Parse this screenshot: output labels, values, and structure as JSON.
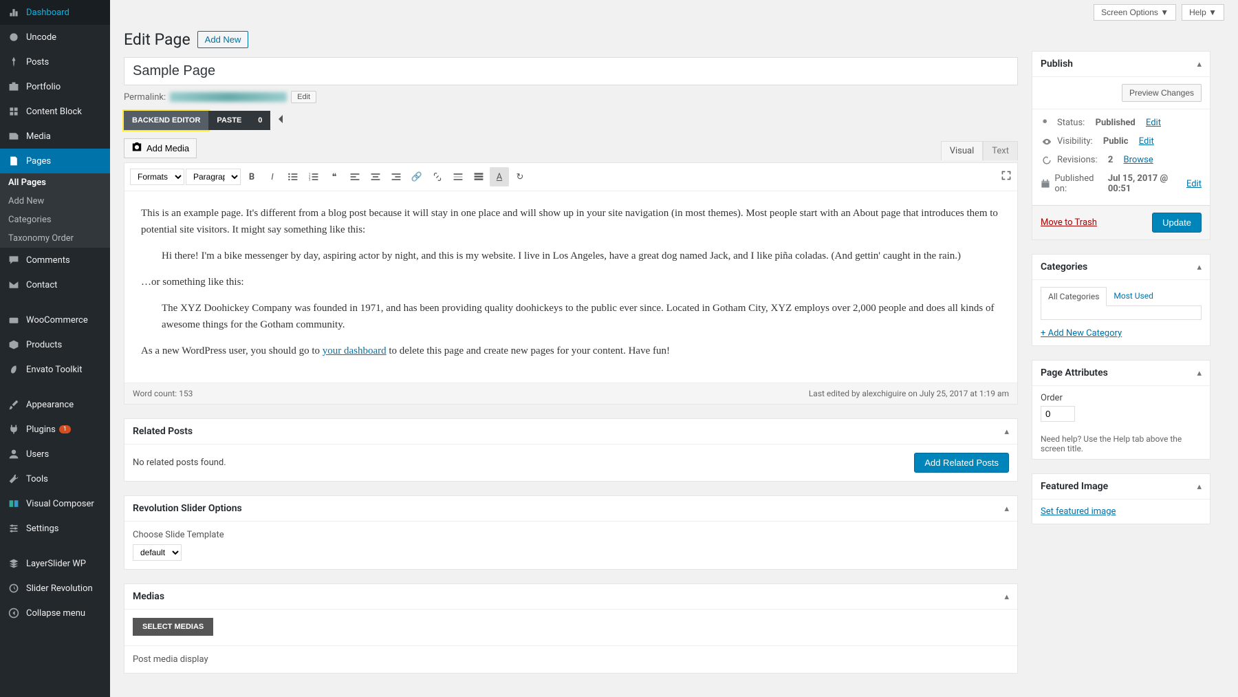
{
  "topbar": {
    "screen_options": "Screen Options",
    "help": "Help"
  },
  "sidebar": {
    "items": [
      {
        "label": "Dashboard"
      },
      {
        "label": "Uncode"
      },
      {
        "label": "Posts"
      },
      {
        "label": "Portfolio"
      },
      {
        "label": "Content Block"
      },
      {
        "label": "Media"
      },
      {
        "label": "Pages"
      },
      {
        "label": "Comments"
      },
      {
        "label": "Contact"
      },
      {
        "label": "WooCommerce"
      },
      {
        "label": "Products"
      },
      {
        "label": "Envato Toolkit"
      },
      {
        "label": "Appearance"
      },
      {
        "label": "Plugins",
        "badge": "1"
      },
      {
        "label": "Users"
      },
      {
        "label": "Tools"
      },
      {
        "label": "Visual Composer"
      },
      {
        "label": "Settings"
      },
      {
        "label": "LayerSlider WP"
      },
      {
        "label": "Slider Revolution"
      },
      {
        "label": "Collapse menu"
      }
    ],
    "sub": {
      "all_pages": "All Pages",
      "add_new": "Add New",
      "categories": "Categories",
      "taxonomy_order": "Taxonomy Order"
    }
  },
  "header": {
    "title": "Edit Page",
    "add_new": "Add New"
  },
  "post": {
    "title": "Sample Page",
    "permalink_label": "Permalink:",
    "edit": "Edit"
  },
  "editor_tabs": {
    "backend": "BACKEND EDITOR",
    "paste": "PASTE",
    "zero": "0"
  },
  "add_media": "Add Media",
  "view_tabs": {
    "visual": "Visual",
    "text": "Text"
  },
  "toolbar": {
    "formats": "Formats",
    "paragraph": "Paragraph"
  },
  "content": {
    "p1": "This is an example page. It's different from a blog post because it will stay in one place and will show up in your site navigation (in most themes). Most people start with an About page that introduces them to potential site visitors. It might say something like this:",
    "q1": "Hi there! I'm a bike messenger by day, aspiring actor by night, and this is my website. I live in Los Angeles, have a great dog named Jack, and I like piña coladas. (And gettin' caught in the rain.)",
    "p2": "…or something like this:",
    "q2": "The XYZ Doohickey Company was founded in 1971, and has been providing quality doohickeys to the public ever since. Located in Gotham City, XYZ employs over 2,000 people and does all kinds of awesome things for the Gotham community.",
    "p3a": "As a new WordPress user, you should go to ",
    "p3link": "your dashboard",
    "p3b": " to delete this page and create new pages for your content. Have fun!"
  },
  "editor_footer": {
    "word_count": "Word count: 153",
    "last_edited": "Last edited by alexchiguire on July 25, 2017 at 1:19 am"
  },
  "related": {
    "title": "Related Posts",
    "empty": "No related posts found.",
    "add": "Add Related Posts"
  },
  "revslider": {
    "title": "Revolution Slider Options",
    "choose": "Choose Slide Template",
    "default": "default"
  },
  "medias": {
    "title": "Medias",
    "select": "SELECT MEDIAS",
    "post_display": "Post media display"
  },
  "publish": {
    "title": "Publish",
    "preview": "Preview Changes",
    "status_lbl": "Status:",
    "status_val": "Published",
    "visibility_lbl": "Visibility:",
    "visibility_val": "Public",
    "revisions_lbl": "Revisions:",
    "revisions_val": "2",
    "browse": "Browse",
    "published_lbl": "Published on:",
    "published_val": "Jul 15, 2017 @ 00:51",
    "edit": "Edit",
    "trash": "Move to Trash",
    "update": "Update"
  },
  "categories": {
    "title": "Categories",
    "all": "All Categories",
    "most": "Most Used",
    "add_new": "+ Add New Category"
  },
  "attrs": {
    "title": "Page Attributes",
    "order_lbl": "Order",
    "order_val": "0",
    "help": "Need help? Use the Help tab above the screen title."
  },
  "featured": {
    "title": "Featured Image",
    "set": "Set featured image"
  }
}
